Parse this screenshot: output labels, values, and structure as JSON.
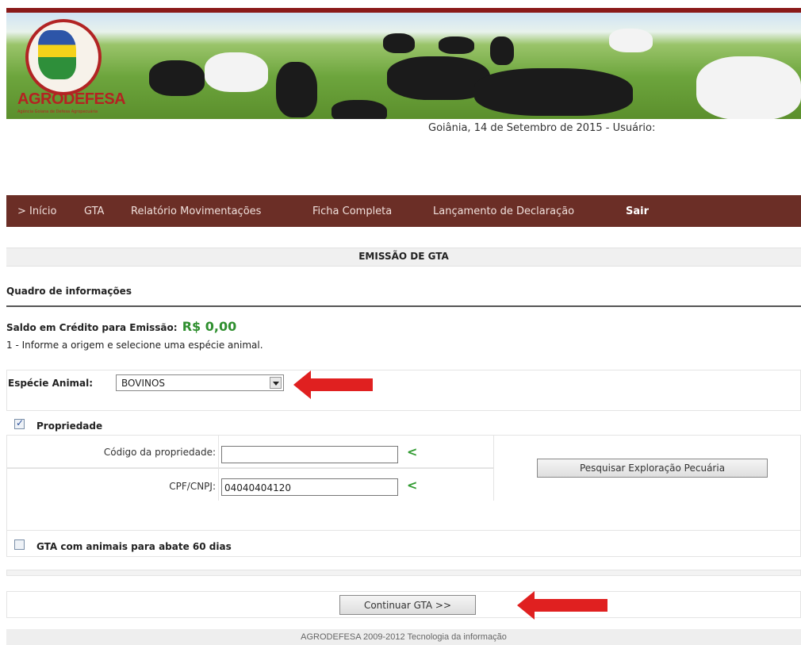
{
  "header": {
    "logo_text": "AGRODEFESA",
    "logo_subtitle": "Agência Goiana de Defesa Agropecuária",
    "dateline": "Goiânia, 14 de Setembro de 2015 - Usuário:"
  },
  "nav": {
    "items": [
      "> Início",
      "GTA",
      "Relatório Movimentações",
      "Ficha Completa",
      "Lançamento de Declaração"
    ],
    "logout": "Sair"
  },
  "page": {
    "title": "EMISSÃO DE GTA"
  },
  "info": {
    "heading": "Quadro de informações",
    "saldo_label": "Saldo em Crédito para Emissão:",
    "saldo_value": "R$ 0,00",
    "instruction": "1 - Informe a origem e selecione uma espécie animal."
  },
  "species": {
    "label": "Espécie Animal:",
    "selected": "BOVINOS"
  },
  "propriedade": {
    "label": "Propriedade",
    "checked": true,
    "codigo_label": "Código da propriedade:",
    "codigo_value": "",
    "cpf_label": "CPF/CNPJ:",
    "cpf_value": "04040404120",
    "search_button": "Pesquisar Exploração Pecuária"
  },
  "abate": {
    "label": "GTA com animais para abate 60 dias",
    "checked": false
  },
  "actions": {
    "continue_button": "Continuar GTA >>"
  },
  "footer": {
    "text": "AGRODEFESA 2009-2012 Tecnologia da informação"
  },
  "colors": {
    "nav_bg": "#6b2e26",
    "saldo_green": "#2f8f2f",
    "annotation_arrow": "#e02020"
  }
}
